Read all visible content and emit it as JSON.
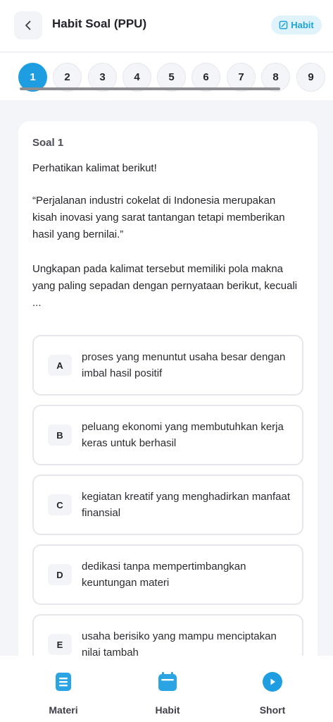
{
  "header": {
    "title": "Habit Soal (PPU)",
    "habit_button": "Habit"
  },
  "numbers": [
    "1",
    "2",
    "3",
    "4",
    "5",
    "6",
    "7",
    "8",
    "9"
  ],
  "active_number": "1",
  "question": {
    "label": "Soal 1",
    "intro": "Perhatikan kalimat berikut!",
    "quote": "“Perjalanan industri cokelat di Indonesia merupakan kisah inovasi yang sarat tantangan tetapi memberikan hasil yang bernilai.”",
    "prompt": "Ungkapan pada kalimat tersebut memiliki pola makna yang paling sepadan dengan pernyataan berikut, kecuali ..."
  },
  "options": [
    {
      "letter": "A",
      "text": "proses yang menuntut usaha besar dengan imbal hasil positif"
    },
    {
      "letter": "B",
      "text": "peluang ekonomi yang membutuhkan kerja keras untuk berhasil"
    },
    {
      "letter": "C",
      "text": "kegiatan kreatif yang menghadirkan manfaat finansial"
    },
    {
      "letter": "D",
      "text": "dedikasi tanpa mempertimbangkan keuntungan materi"
    },
    {
      "letter": "E",
      "text": "usaha berisiko yang mampu menciptakan nilai tambah"
    }
  ],
  "bottom_nav": {
    "materi": "Materi",
    "habit": "Habit",
    "short": "Short"
  },
  "colors": {
    "accent": "#1e9ee0",
    "pill_bg": "#e0f3fb"
  },
  "icons": {
    "back": "chevron-left-icon",
    "habit": "edit-icon",
    "materi": "document-icon",
    "nav_habit": "calendar-icon",
    "short": "play-icon"
  }
}
